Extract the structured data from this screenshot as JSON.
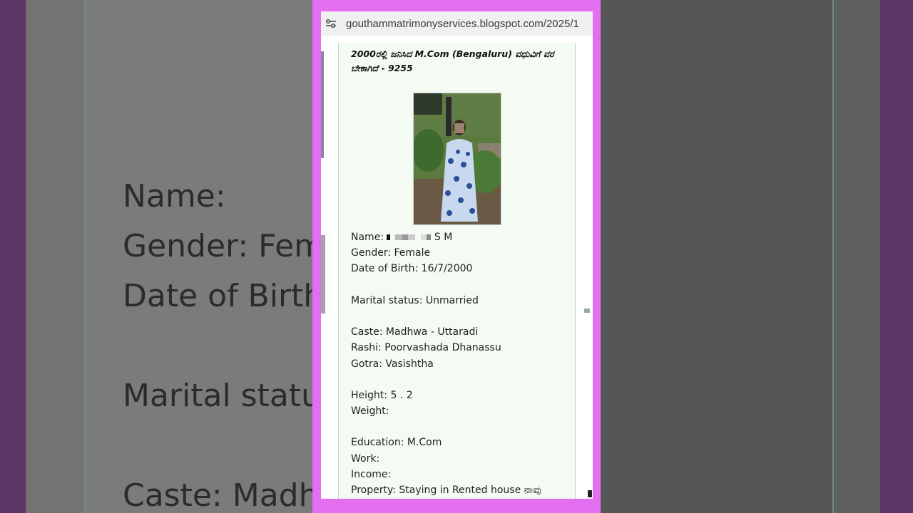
{
  "browser": {
    "url": "gouthammatrimonyservices.blogspot.com/2025/1"
  },
  "post": {
    "title": "2000ರಲ್ಲಿ ಜನಿಸಿದ M.Com (Bengaluru) ವಧುವಿಗೆ ವರ ಬೇಕಾಗಿದೆ - 9255",
    "photo_alt": "woman in blue floral dress",
    "details": [
      {
        "key": "name",
        "text_before": "Name: ",
        "text_after": " S M"
      },
      {
        "key": "gender",
        "text": "Gender: Female"
      },
      {
        "key": "dob",
        "text": "Date of Birth: 16/7/2000"
      },
      {
        "key": "gap1",
        "gap": true
      },
      {
        "key": "marital",
        "text": "Marital status: Unmarried"
      },
      {
        "key": "gap2",
        "gap": true
      },
      {
        "key": "caste",
        "text": "Caste: Madhwa - Uttaradi"
      },
      {
        "key": "rashi",
        "text": "Rashi: Poorvashada Dhanassu"
      },
      {
        "key": "gotra",
        "text": "Gotra: Vasishtha"
      },
      {
        "key": "gap3",
        "gap": true
      },
      {
        "key": "height",
        "text": "Height: 5 . 2"
      },
      {
        "key": "weight",
        "text": "Weight:"
      },
      {
        "key": "gap4",
        "gap": true
      },
      {
        "key": "education",
        "text": "Education: M.Com"
      },
      {
        "key": "work",
        "text": "Work:"
      },
      {
        "key": "income",
        "text": "Income:"
      },
      {
        "key": "property",
        "text": "Property: Staying in Rented house ನಾವು"
      }
    ]
  },
  "background_zoom": {
    "lines": [
      "Name: ",
      "Gender: Fem",
      "Date of Birth",
      "Marital statu",
      "Caste: Madh"
    ]
  },
  "colors": {
    "frame": "#e36ef0",
    "card": "#f3fbf3"
  }
}
